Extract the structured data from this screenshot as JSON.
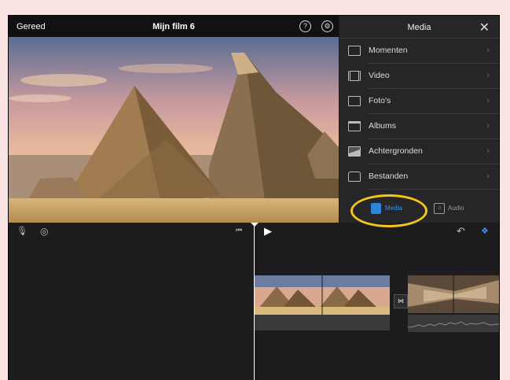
{
  "topbar": {
    "done_label": "Gereed",
    "title": "Mijn film 6",
    "help_glyph": "?",
    "settings_glyph": "⚙"
  },
  "media_panel": {
    "title": "Media",
    "close_glyph": "✕",
    "items": [
      {
        "label": "Momenten",
        "icon": "moments-icon"
      },
      {
        "label": "Video",
        "icon": "video-film-icon"
      },
      {
        "label": "Foto's",
        "icon": "photos-icon"
      },
      {
        "label": "Albums",
        "icon": "albums-icon"
      },
      {
        "label": "Achtergronden",
        "icon": "backgrounds-icon"
      },
      {
        "label": "Bestanden",
        "icon": "folder-icon"
      }
    ],
    "chevron": "›",
    "tabs": {
      "media": "Media",
      "audio": "Audio",
      "audio_glyph": "♫"
    }
  },
  "timeline_toolbar": {
    "mic_glyph": "🎙",
    "camera_glyph": "◎",
    "skip_back_glyph": "⏮",
    "play_glyph": "▶",
    "undo_glyph": "↶",
    "waveform_glyph": "❖"
  },
  "transition_glyph": "⋈",
  "colors": {
    "accent": "#2d86d9",
    "highlight": "#f2c61b",
    "panel": "#262628",
    "background": "#1c1c1e"
  }
}
